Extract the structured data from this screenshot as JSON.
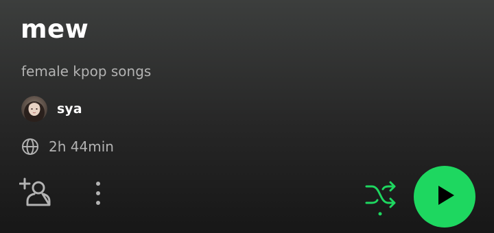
{
  "playlist": {
    "title": "mew",
    "description": "female kpop songs",
    "owner": "sya",
    "duration": "2h 44min"
  },
  "icons": {
    "visibility": "globe-icon",
    "add_collaborator": "add-user-icon",
    "more": "more-vertical-icon",
    "shuffle": "shuffle-icon",
    "play": "play-icon"
  },
  "colors": {
    "accent": "#1ed760",
    "text_primary": "#ffffff",
    "text_secondary": "#b3b3b3",
    "play_icon": "#000000"
  },
  "state": {
    "shuffle_enabled": true
  }
}
